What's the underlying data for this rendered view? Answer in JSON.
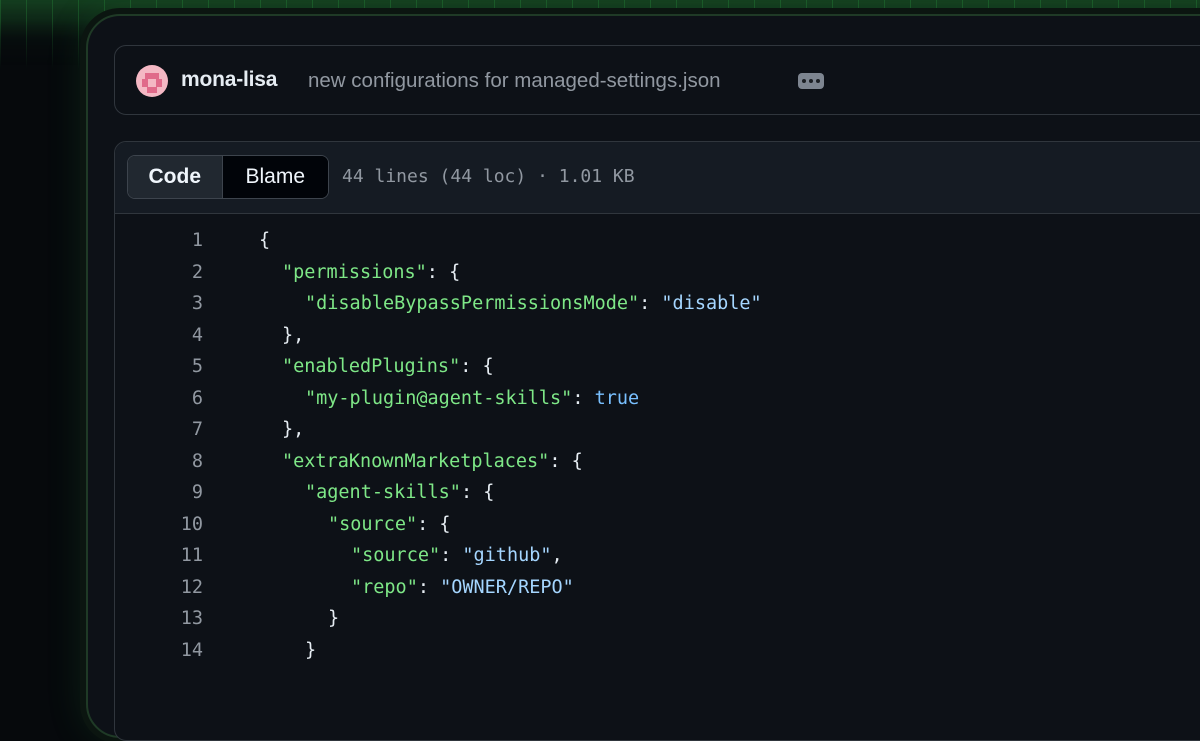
{
  "commit": {
    "author": "mona-lisa",
    "message": "new configurations for managed-settings.json",
    "more_icon": "kebab-horizontal-icon"
  },
  "file": {
    "tabs": [
      "Code",
      "Blame"
    ],
    "active_tab": "Code",
    "meta": "44 lines (44 loc) · 1.01 KB"
  },
  "code": {
    "lines": [
      {
        "n": "1",
        "indent": 0,
        "parts": [
          {
            "t": "{",
            "c": "p"
          }
        ]
      },
      {
        "n": "2",
        "indent": 1,
        "parts": [
          {
            "t": "\"permissions\"",
            "c": "k"
          },
          {
            "t": ": {",
            "c": "p"
          }
        ]
      },
      {
        "n": "3",
        "indent": 2,
        "parts": [
          {
            "t": "\"disableBypassPermissionsMode\"",
            "c": "k"
          },
          {
            "t": ": ",
            "c": "p"
          },
          {
            "t": "\"disable\"",
            "c": "s"
          }
        ]
      },
      {
        "n": "4",
        "indent": 1,
        "parts": [
          {
            "t": "},",
            "c": "p"
          }
        ]
      },
      {
        "n": "5",
        "indent": 1,
        "parts": [
          {
            "t": "\"enabledPlugins\"",
            "c": "k"
          },
          {
            "t": ": {",
            "c": "p"
          }
        ]
      },
      {
        "n": "6",
        "indent": 2,
        "parts": [
          {
            "t": "\"my-plugin@agent-skills\"",
            "c": "k"
          },
          {
            "t": ": ",
            "c": "p"
          },
          {
            "t": "true",
            "c": "b"
          }
        ]
      },
      {
        "n": "7",
        "indent": 1,
        "parts": [
          {
            "t": "},",
            "c": "p"
          }
        ]
      },
      {
        "n": "8",
        "indent": 1,
        "parts": [
          {
            "t": "\"extraKnownMarketplaces\"",
            "c": "k"
          },
          {
            "t": ": {",
            "c": "p"
          }
        ]
      },
      {
        "n": "9",
        "indent": 2,
        "parts": [
          {
            "t": "\"agent-skills\"",
            "c": "k"
          },
          {
            "t": ": {",
            "c": "p"
          }
        ]
      },
      {
        "n": "10",
        "indent": 3,
        "parts": [
          {
            "t": "\"source\"",
            "c": "k"
          },
          {
            "t": ": {",
            "c": "p"
          }
        ]
      },
      {
        "n": "11",
        "indent": 4,
        "parts": [
          {
            "t": "\"source\"",
            "c": "k"
          },
          {
            "t": ": ",
            "c": "p"
          },
          {
            "t": "\"github\"",
            "c": "s"
          },
          {
            "t": ",",
            "c": "p"
          }
        ]
      },
      {
        "n": "12",
        "indent": 4,
        "parts": [
          {
            "t": "\"repo\"",
            "c": "k"
          },
          {
            "t": ": ",
            "c": "p"
          },
          {
            "t": "\"OWNER/REPO\"",
            "c": "s"
          }
        ]
      },
      {
        "n": "13",
        "indent": 3,
        "parts": [
          {
            "t": "}",
            "c": "p"
          }
        ]
      },
      {
        "n": "14",
        "indent": 2,
        "parts": [
          {
            "t": "}",
            "c": "p"
          }
        ]
      }
    ]
  },
  "colors": {
    "key": "#7ee787",
    "string": "#a5d6ff",
    "boolean": "#79c0ff",
    "accent_glow": "#2ea043"
  }
}
